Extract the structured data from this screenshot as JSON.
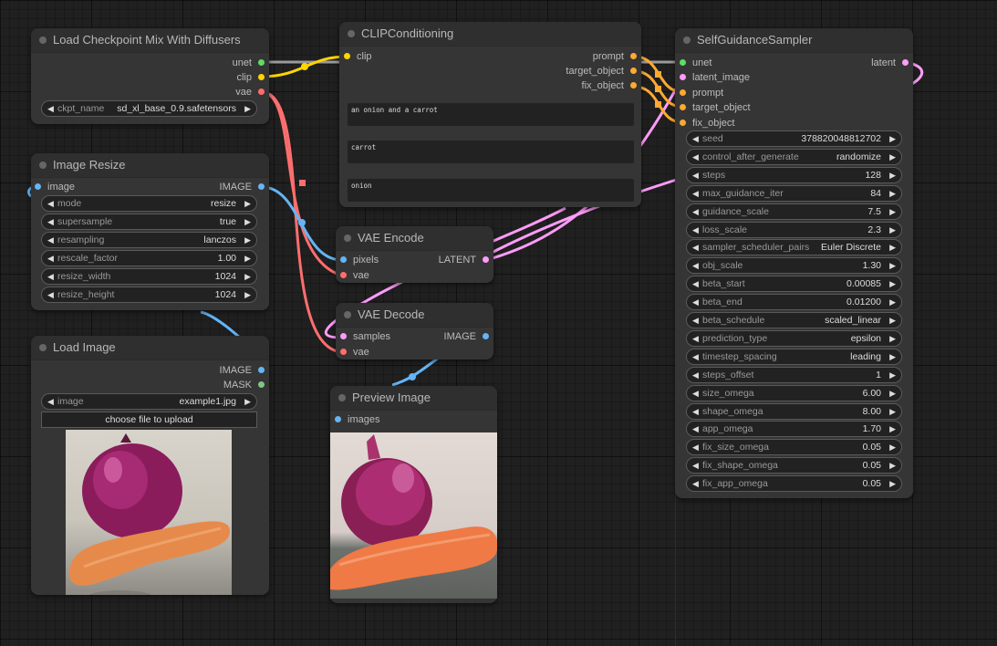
{
  "colors": {
    "model": "#5fdd61",
    "clip": "#ffd500",
    "vae": "#ff6e6e",
    "image": "#64b5f6",
    "mask": "#81c784",
    "latent": "#ff9cf9",
    "conditioning": "#ffa931"
  },
  "nodes": {
    "checkpoint": {
      "title": "Load Checkpoint Mix With Diffusers",
      "outputs": [
        "unet",
        "clip",
        "vae"
      ],
      "widgets": [
        {
          "label": "ckpt_name",
          "value": "sd_xl_base_0.9.safetensors"
        }
      ]
    },
    "resize": {
      "title": "Image Resize",
      "input": "image",
      "output": "IMAGE",
      "widgets": [
        {
          "label": "mode",
          "value": "resize"
        },
        {
          "label": "supersample",
          "value": "true"
        },
        {
          "label": "resampling",
          "value": "lanczos"
        },
        {
          "label": "rescale_factor",
          "value": "1.00"
        },
        {
          "label": "resize_width",
          "value": "1024"
        },
        {
          "label": "resize_height",
          "value": "1024"
        }
      ]
    },
    "load_image": {
      "title": "Load Image",
      "outputs": [
        "IMAGE",
        "MASK"
      ],
      "widgets": [
        {
          "label": "image",
          "value": "example1.jpg"
        }
      ],
      "upload_label": "choose file to upload"
    },
    "clip_cond": {
      "title": "CLIPConditioning",
      "input": "clip",
      "outputs": [
        "prompt",
        "target_object",
        "fix_object"
      ],
      "texts": [
        "an onion and a carrot",
        "carrot",
        "onion"
      ]
    },
    "vae_encode": {
      "title": "VAE Encode",
      "inputs": [
        "pixels",
        "vae"
      ],
      "output": "LATENT"
    },
    "vae_decode": {
      "title": "VAE Decode",
      "inputs": [
        "samples",
        "vae"
      ],
      "output": "IMAGE"
    },
    "preview": {
      "title": "Preview Image",
      "input": "images"
    },
    "sampler": {
      "title": "SelfGuidanceSampler",
      "inputs": [
        "unet",
        "latent_image",
        "prompt",
        "target_object",
        "fix_object"
      ],
      "output": "latent",
      "widgets": [
        {
          "label": "seed",
          "value": "378820048812702"
        },
        {
          "label": "control_after_generate",
          "value": "randomize"
        },
        {
          "label": "steps",
          "value": "128"
        },
        {
          "label": "max_guidance_iter",
          "value": "84"
        },
        {
          "label": "guidance_scale",
          "value": "7.5"
        },
        {
          "label": "loss_scale",
          "value": "2.3"
        },
        {
          "label": "sampler_scheduler_pairs",
          "value": "Euler Discrete"
        },
        {
          "label": "obj_scale",
          "value": "1.30"
        },
        {
          "label": "beta_start",
          "value": "0.00085"
        },
        {
          "label": "beta_end",
          "value": "0.01200"
        },
        {
          "label": "beta_schedule",
          "value": "scaled_linear"
        },
        {
          "label": "prediction_type",
          "value": "epsilon"
        },
        {
          "label": "timestep_spacing",
          "value": "leading"
        },
        {
          "label": "steps_offset",
          "value": "1"
        },
        {
          "label": "size_omega",
          "value": "6.00"
        },
        {
          "label": "shape_omega",
          "value": "8.00"
        },
        {
          "label": "app_omega",
          "value": "1.70"
        },
        {
          "label": "fix_size_omega",
          "value": "0.05"
        },
        {
          "label": "fix_shape_omega",
          "value": "0.05"
        },
        {
          "label": "fix_app_omega",
          "value": "0.05"
        }
      ]
    }
  },
  "icons": {
    "arrow_left": "◀",
    "arrow_right": "▶"
  }
}
